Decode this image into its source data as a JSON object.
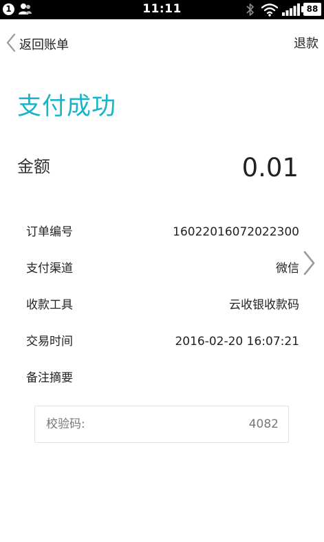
{
  "status_bar": {
    "notification_count": "1",
    "time": "11:11",
    "battery": "88"
  },
  "nav": {
    "back_label": "返回账单",
    "refund_label": "退款"
  },
  "page_title": "支付成功",
  "amount": {
    "label": "金额",
    "value": "0.01"
  },
  "details": {
    "order_no": {
      "label": "订单编号",
      "value": "16022016072022300"
    },
    "channel": {
      "label": "支付渠道",
      "value": "微信"
    },
    "tool": {
      "label": "收款工具",
      "value": "云收银收款码"
    },
    "time": {
      "label": "交易时间",
      "value": "2016-02-20 16:07:21"
    },
    "remark": {
      "label": "备注摘要",
      "value": ""
    }
  },
  "verify": {
    "label": "校验码:",
    "value": "4082"
  },
  "colors": {
    "accent": "#16b5c8",
    "status_bar": "#000000",
    "text": "#222222",
    "muted": "#777777"
  },
  "icons": {
    "back": "chevron-left-icon",
    "channel_arrow": "chevron-right-icon",
    "contact": "contact-icon",
    "bluetooth": "bluetooth-icon",
    "wifi": "wifi-icon",
    "signal": "signal-icon"
  }
}
